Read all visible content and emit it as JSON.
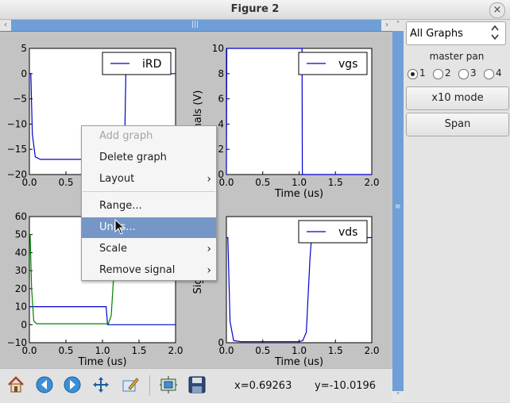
{
  "window": {
    "title": "Figure 2",
    "close_glyph": "×"
  },
  "scroll": {
    "left_arrow": "‹",
    "right_arrow": "›",
    "up_arrow": "˄",
    "down_arrow": "˅",
    "grip_h": "|||",
    "grip_v": "≡"
  },
  "side_panel": {
    "graph_select": "All Graphs",
    "master_pan_label": "master pan",
    "radios": [
      {
        "label": "1",
        "checked": true
      },
      {
        "label": "2",
        "checked": false
      },
      {
        "label": "3",
        "checked": false
      },
      {
        "label": "4",
        "checked": false
      }
    ],
    "x10_button": "x10 mode",
    "span_button": "Span"
  },
  "context_menu": {
    "items": [
      {
        "label": "Add graph",
        "disabled": true,
        "submenu": false
      },
      {
        "label": "Delete graph",
        "disabled": false,
        "submenu": false
      },
      {
        "label": "Layout",
        "disabled": false,
        "submenu": true
      },
      {
        "label": "Range...",
        "disabled": false,
        "submenu": false
      },
      {
        "label": "Units...",
        "disabled": false,
        "submenu": false,
        "highlighted": true
      },
      {
        "label": "Scale",
        "disabled": false,
        "submenu": true
      },
      {
        "label": "Remove signal",
        "disabled": false,
        "submenu": true
      }
    ],
    "submenu_glyph": "›"
  },
  "toolbar": {
    "icons": [
      "home-icon",
      "back-icon",
      "forward-icon",
      "pan-icon",
      "edit-icon",
      "subplots-icon",
      "save-icon"
    ],
    "x_readout": "x=0.69263",
    "y_readout": "y=-10.0196"
  },
  "colors": {
    "blue": "#0000cc",
    "green": "#008000",
    "menu_highlight": "#7596c6",
    "scroll": "#6f9fd6"
  },
  "chart_data": [
    {
      "type": "line",
      "title": "",
      "xlabel": "Ti",
      "ylabel": "",
      "xlim": [
        0,
        2.0
      ],
      "ylim": [
        -20,
        5
      ],
      "x_ticks": [
        "0.0",
        "0.5"
      ],
      "y_ticks": [
        "5",
        "0",
        "−5",
        "−10",
        "−15",
        "−20"
      ],
      "series": [
        {
          "name": "iRD",
          "color": "#0000cc",
          "x": [
            0,
            0.02,
            0.04,
            0.08,
            0.15,
            0.4,
            0.8,
            1.0,
            1.2,
            1.3,
            1.32,
            1.6,
            2.0
          ],
          "y": [
            0,
            0,
            -12,
            -16.5,
            -17,
            -17,
            -17,
            -17,
            -17,
            -17,
            0,
            0,
            0
          ]
        }
      ]
    },
    {
      "type": "line",
      "title": "",
      "xlabel": "Time (us)",
      "ylabel": "nals (V)",
      "xlim": [
        0,
        2.0
      ],
      "ylim": [
        0,
        10
      ],
      "x_ticks": [
        "0.0",
        "0.5",
        "1.0",
        "1.5",
        "2.0"
      ],
      "y_ticks": [
        "10",
        "8",
        "6",
        "4",
        "2",
        "0"
      ],
      "series": [
        {
          "name": "vgs",
          "color": "#0000cc",
          "x": [
            0,
            0.005,
            1.04,
            1.045,
            2.0
          ],
          "y": [
            0,
            10,
            10,
            0,
            0
          ]
        }
      ]
    },
    {
      "type": "line",
      "title": "",
      "xlabel": "Time (us)",
      "ylabel": "",
      "xlim": [
        0,
        2.0
      ],
      "ylim": [
        -10,
        60
      ],
      "x_ticks": [
        "0.0",
        "0.5",
        "1.0",
        "1.5",
        "2.0"
      ],
      "y_ticks": [
        "60",
        "50",
        "40",
        "30",
        "20",
        "10",
        "0",
        "−10"
      ],
      "series": [
        {
          "color": "#0000cc",
          "x": [
            0,
            0.01,
            0.03,
            0.06,
            1.0,
            1.05,
            1.07,
            2.0
          ],
          "y": [
            10,
            10,
            10,
            10,
            10,
            10,
            0,
            0
          ]
        },
        {
          "color": "#008000",
          "x": [
            0,
            0.01,
            0.03,
            0.06,
            0.1,
            1.08,
            1.12,
            1.15,
            1.18,
            1.2,
            2.0
          ],
          "y": [
            50,
            50,
            20,
            2,
            0.5,
            0.5,
            5,
            25,
            50,
            60,
            60
          ]
        }
      ]
    },
    {
      "type": "line",
      "title": "",
      "xlabel": "Time (us)",
      "ylabel": "Signal",
      "xlim": [
        0,
        2.0
      ],
      "ylim": [
        0,
        60
      ],
      "x_ticks": [
        "0.0",
        "0.5",
        "1.0",
        "1.5",
        "2.0"
      ],
      "y_ticks": [
        "0"
      ],
      "series": [
        {
          "name": "vds",
          "color": "#0000cc",
          "x": [
            0,
            0.02,
            0.05,
            0.1,
            0.2,
            0.9,
            1.0,
            1.05,
            1.1,
            1.15,
            1.17,
            2.0
          ],
          "y": [
            50,
            50,
            10,
            1,
            0.5,
            0.5,
            0.5,
            1,
            5,
            40,
            50,
            50
          ]
        }
      ]
    }
  ]
}
